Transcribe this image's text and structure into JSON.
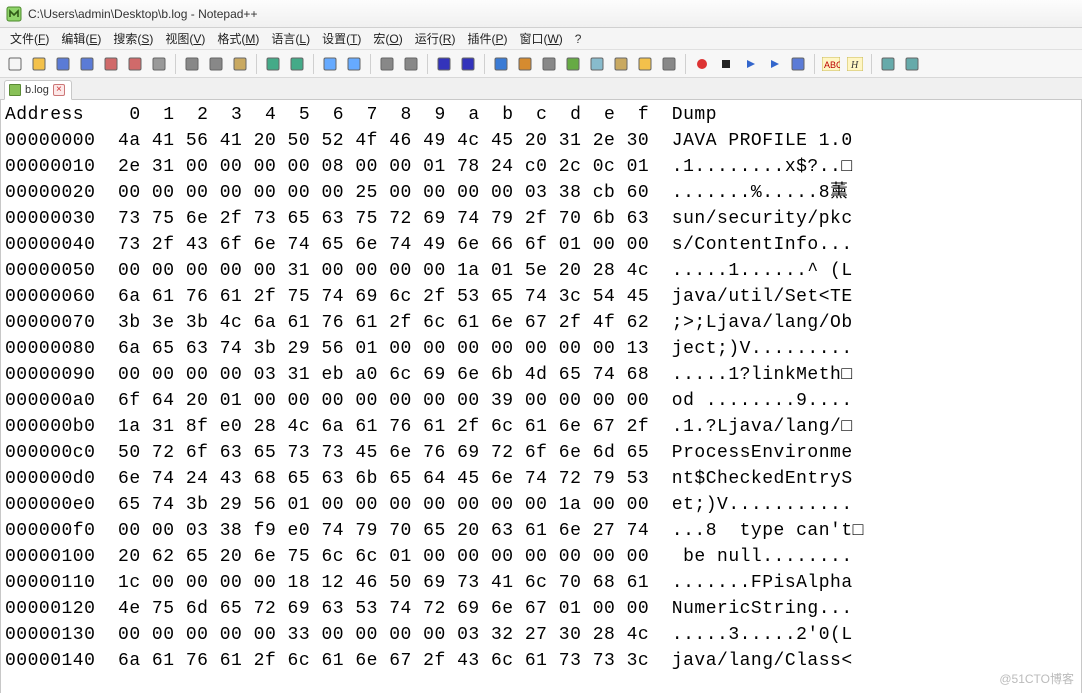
{
  "window": {
    "title": "C:\\Users\\admin\\Desktop\\b.log - Notepad++"
  },
  "menu": {
    "items": [
      {
        "label": "文件",
        "accel": "F"
      },
      {
        "label": "编辑",
        "accel": "E"
      },
      {
        "label": "搜索",
        "accel": "S"
      },
      {
        "label": "视图",
        "accel": "V"
      },
      {
        "label": "格式",
        "accel": "M"
      },
      {
        "label": "语言",
        "accel": "L"
      },
      {
        "label": "设置",
        "accel": "T"
      },
      {
        "label": "宏",
        "accel": "O"
      },
      {
        "label": "运行",
        "accel": "R"
      },
      {
        "label": "插件",
        "accel": "P"
      },
      {
        "label": "窗口",
        "accel": "W"
      }
    ],
    "help": "?"
  },
  "toolbar_icons": [
    "new-file-icon",
    "open-file-icon",
    "save-icon",
    "save-all-icon",
    "close-icon",
    "close-all-icon",
    "print-icon",
    "SEP",
    "cut-icon",
    "copy-icon",
    "paste-icon",
    "SEP",
    "undo-icon",
    "redo-icon",
    "SEP",
    "find-icon",
    "replace-icon",
    "SEP",
    "zoom-in-icon",
    "zoom-out-icon",
    "SEP",
    "sync-v-icon",
    "sync-h-icon",
    "SEP",
    "wordwrap-icon",
    "all-chars-icon",
    "indent-guide-icon",
    "lang-icon",
    "doc-map-icon",
    "func-list-icon",
    "folder-workspace-icon",
    "monitor-icon",
    "SEP",
    "record-macro-icon",
    "stop-macro-icon",
    "play-macro-icon",
    "play-multi-icon",
    "save-macro-icon",
    "SEP",
    "spellcheck-icon",
    "highlight-icon",
    "SEP",
    "compare-icon",
    "compare-clear-icon"
  ],
  "tab": {
    "label": "b.log",
    "close_tooltip": "Close"
  },
  "hex": {
    "header_addr": "Address",
    "header_cols": [
      "0",
      "1",
      "2",
      "3",
      "4",
      "5",
      "6",
      "7",
      "8",
      "9",
      "a",
      "b",
      "c",
      "d",
      "e",
      "f"
    ],
    "header_dump": "Dump",
    "rows": [
      {
        "addr": "00000000",
        "bytes": [
          "4a",
          "41",
          "56",
          "41",
          "20",
          "50",
          "52",
          "4f",
          "46",
          "49",
          "4c",
          "45",
          "20",
          "31",
          "2e",
          "30"
        ],
        "dump": "JAVA PROFILE 1.0"
      },
      {
        "addr": "00000010",
        "bytes": [
          "2e",
          "31",
          "00",
          "00",
          "00",
          "00",
          "08",
          "00",
          "00",
          "01",
          "78",
          "24",
          "c0",
          "2c",
          "0c",
          "01"
        ],
        "dump": ".1........x$?..□"
      },
      {
        "addr": "00000020",
        "bytes": [
          "00",
          "00",
          "00",
          "00",
          "00",
          "00",
          "00",
          "25",
          "00",
          "00",
          "00",
          "00",
          "03",
          "38",
          "cb",
          "60"
        ],
        "dump": ".......%.....8薰"
      },
      {
        "addr": "00000030",
        "bytes": [
          "73",
          "75",
          "6e",
          "2f",
          "73",
          "65",
          "63",
          "75",
          "72",
          "69",
          "74",
          "79",
          "2f",
          "70",
          "6b",
          "63"
        ],
        "dump": "sun/security/pkc"
      },
      {
        "addr": "00000040",
        "bytes": [
          "73",
          "2f",
          "43",
          "6f",
          "6e",
          "74",
          "65",
          "6e",
          "74",
          "49",
          "6e",
          "66",
          "6f",
          "01",
          "00",
          "00"
        ],
        "dump": "s/ContentInfo..."
      },
      {
        "addr": "00000050",
        "bytes": [
          "00",
          "00",
          "00",
          "00",
          "00",
          "31",
          "00",
          "00",
          "00",
          "00",
          "1a",
          "01",
          "5e",
          "20",
          "28",
          "4c"
        ],
        "dump": ".....1......^ (L"
      },
      {
        "addr": "00000060",
        "bytes": [
          "6a",
          "61",
          "76",
          "61",
          "2f",
          "75",
          "74",
          "69",
          "6c",
          "2f",
          "53",
          "65",
          "74",
          "3c",
          "54",
          "45"
        ],
        "dump": "java/util/Set<TE"
      },
      {
        "addr": "00000070",
        "bytes": [
          "3b",
          "3e",
          "3b",
          "4c",
          "6a",
          "61",
          "76",
          "61",
          "2f",
          "6c",
          "61",
          "6e",
          "67",
          "2f",
          "4f",
          "62"
        ],
        "dump": ";>;Ljava/lang/Ob"
      },
      {
        "addr": "00000080",
        "bytes": [
          "6a",
          "65",
          "63",
          "74",
          "3b",
          "29",
          "56",
          "01",
          "00",
          "00",
          "00",
          "00",
          "00",
          "00",
          "00",
          "13"
        ],
        "dump": "ject;)V........."
      },
      {
        "addr": "00000090",
        "bytes": [
          "00",
          "00",
          "00",
          "00",
          "03",
          "31",
          "eb",
          "a0",
          "6c",
          "69",
          "6e",
          "6b",
          "4d",
          "65",
          "74",
          "68"
        ],
        "dump": ".....1?linkMeth□"
      },
      {
        "addr": "000000a0",
        "bytes": [
          "6f",
          "64",
          "20",
          "01",
          "00",
          "00",
          "00",
          "00",
          "00",
          "00",
          "00",
          "39",
          "00",
          "00",
          "00",
          "00"
        ],
        "dump": "od ........9...."
      },
      {
        "addr": "000000b0",
        "bytes": [
          "1a",
          "31",
          "8f",
          "e0",
          "28",
          "4c",
          "6a",
          "61",
          "76",
          "61",
          "2f",
          "6c",
          "61",
          "6e",
          "67",
          "2f"
        ],
        "dump": ".1.?Ljava/lang/□"
      },
      {
        "addr": "000000c0",
        "bytes": [
          "50",
          "72",
          "6f",
          "63",
          "65",
          "73",
          "73",
          "45",
          "6e",
          "76",
          "69",
          "72",
          "6f",
          "6e",
          "6d",
          "65"
        ],
        "dump": "ProcessEnvironme"
      },
      {
        "addr": "000000d0",
        "bytes": [
          "6e",
          "74",
          "24",
          "43",
          "68",
          "65",
          "63",
          "6b",
          "65",
          "64",
          "45",
          "6e",
          "74",
          "72",
          "79",
          "53"
        ],
        "dump": "nt$CheckedEntryS"
      },
      {
        "addr": "000000e0",
        "bytes": [
          "65",
          "74",
          "3b",
          "29",
          "56",
          "01",
          "00",
          "00",
          "00",
          "00",
          "00",
          "00",
          "00",
          "1a",
          "00",
          "00"
        ],
        "dump": "et;)V..........."
      },
      {
        "addr": "000000f0",
        "bytes": [
          "00",
          "00",
          "03",
          "38",
          "f9",
          "e0",
          "74",
          "79",
          "70",
          "65",
          "20",
          "63",
          "61",
          "6e",
          "27",
          "74"
        ],
        "dump": "...8  type can't□"
      },
      {
        "addr": "00000100",
        "bytes": [
          "20",
          "62",
          "65",
          "20",
          "6e",
          "75",
          "6c",
          "6c",
          "01",
          "00",
          "00",
          "00",
          "00",
          "00",
          "00",
          "00"
        ],
        "dump": " be null........"
      },
      {
        "addr": "00000110",
        "bytes": [
          "1c",
          "00",
          "00",
          "00",
          "00",
          "18",
          "12",
          "46",
          "50",
          "69",
          "73",
          "41",
          "6c",
          "70",
          "68",
          "61"
        ],
        "dump": ".......FPisAlpha"
      },
      {
        "addr": "00000120",
        "bytes": [
          "4e",
          "75",
          "6d",
          "65",
          "72",
          "69",
          "63",
          "53",
          "74",
          "72",
          "69",
          "6e",
          "67",
          "01",
          "00",
          "00"
        ],
        "dump": "NumericString..."
      },
      {
        "addr": "00000130",
        "bytes": [
          "00",
          "00",
          "00",
          "00",
          "00",
          "33",
          "00",
          "00",
          "00",
          "00",
          "03",
          "32",
          "27",
          "30",
          "28",
          "4c"
        ],
        "dump": ".....3.....2'0(L"
      },
      {
        "addr": "00000140",
        "bytes": [
          "6a",
          "61",
          "76",
          "61",
          "2f",
          "6c",
          "61",
          "6e",
          "67",
          "2f",
          "43",
          "6c",
          "61",
          "73",
          "73",
          "3c"
        ],
        "dump": "java/lang/Class<"
      }
    ]
  },
  "watermark": "@51CTO博客"
}
